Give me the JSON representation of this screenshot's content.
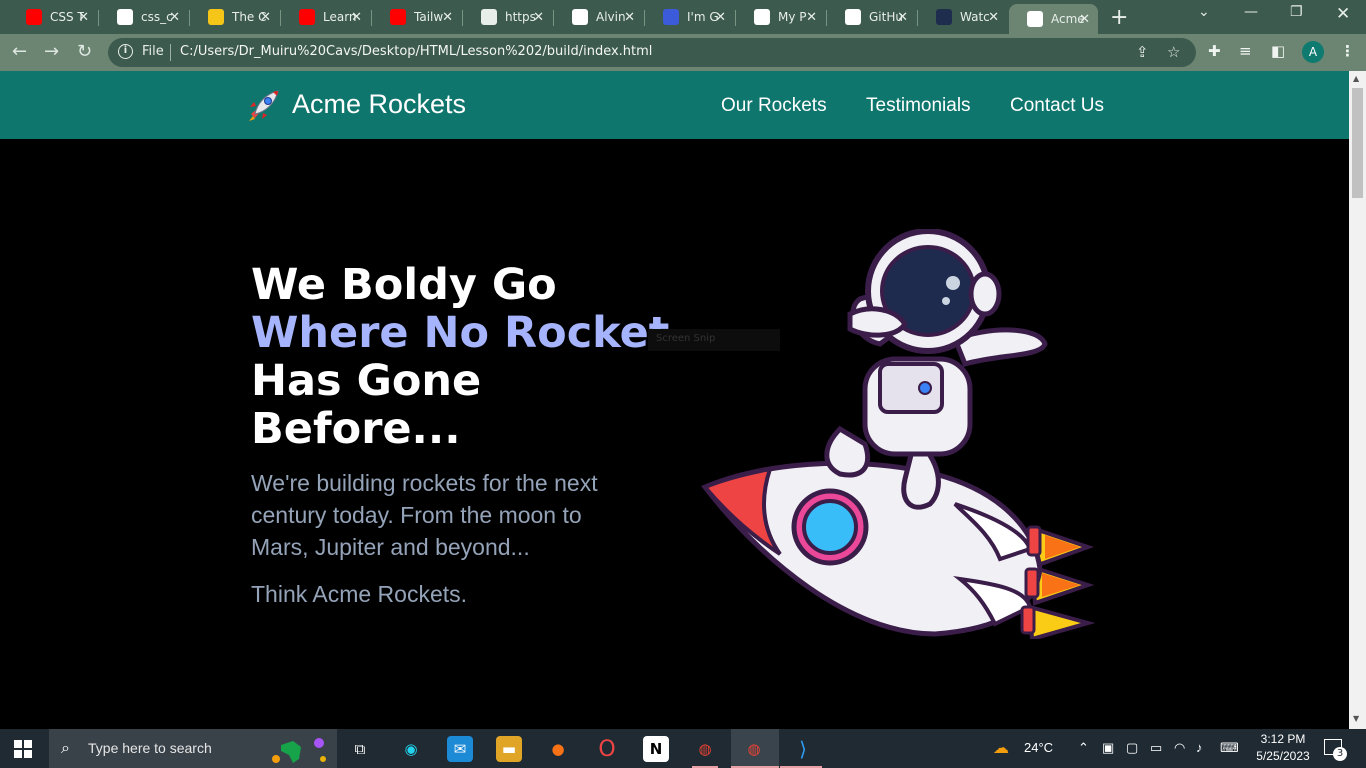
{
  "browser": {
    "tabs": [
      {
        "label": "CSS T",
        "icon": "youtube-icon",
        "color": "#ff0000"
      },
      {
        "label": "css_c",
        "icon": "github-icon",
        "color": "#ffffff"
      },
      {
        "label": "The C",
        "icon": "site-icon",
        "color": "#f5c518"
      },
      {
        "label": "Learn",
        "icon": "youtube-icon",
        "color": "#ff0000"
      },
      {
        "label": "Tailw",
        "icon": "youtube-icon",
        "color": "#ff0000"
      },
      {
        "label": "https",
        "icon": "chatgpt-icon",
        "color": "#e8eee9"
      },
      {
        "label": "Alvin",
        "icon": "github-icon",
        "color": "#ffffff"
      },
      {
        "label": "I'm G",
        "icon": "site-icon",
        "color": "#3b5bdb"
      },
      {
        "label": "My P",
        "icon": "globe-icon",
        "color": "#ffffff"
      },
      {
        "label": "GitHu",
        "icon": "github-icon",
        "color": "#ffffff"
      },
      {
        "label": "Watc",
        "icon": "site-icon",
        "color": "#1e2d4d"
      },
      {
        "label": "Acme",
        "icon": "rocket-icon",
        "color": "#ffffff"
      }
    ],
    "active_tab_index": 11,
    "omnibox": {
      "scheme_label": "File",
      "url": "C:/Users/Dr_Muiru%20Cavs/Desktop/HTML/Lesson%202/build/index.html"
    },
    "profile_initial": "A"
  },
  "site": {
    "brand": "Acme Rockets",
    "nav": [
      "Our Rockets",
      "Testimonials",
      "Contact Us"
    ],
    "hero": {
      "title_line1": "We Boldy Go",
      "title_accent": "Where No Rocket",
      "title_line3": "Has Gone",
      "title_line4": "Before...",
      "text": "We're building rockets for the next century today. From the moon to Mars, Jupiter and beyond...",
      "subtext": "Think Acme Rockets."
    },
    "overlay_label": "Screen Snip",
    "colors": {
      "header_bg": "#0f766e",
      "accent_text": "#a5b4fc",
      "body_text": "#94a3b8"
    }
  },
  "taskbar": {
    "search_placeholder": "Type here to search",
    "weather": "24°C",
    "time": "3:12 PM",
    "date": "5/25/2023",
    "notification_count": "3"
  }
}
